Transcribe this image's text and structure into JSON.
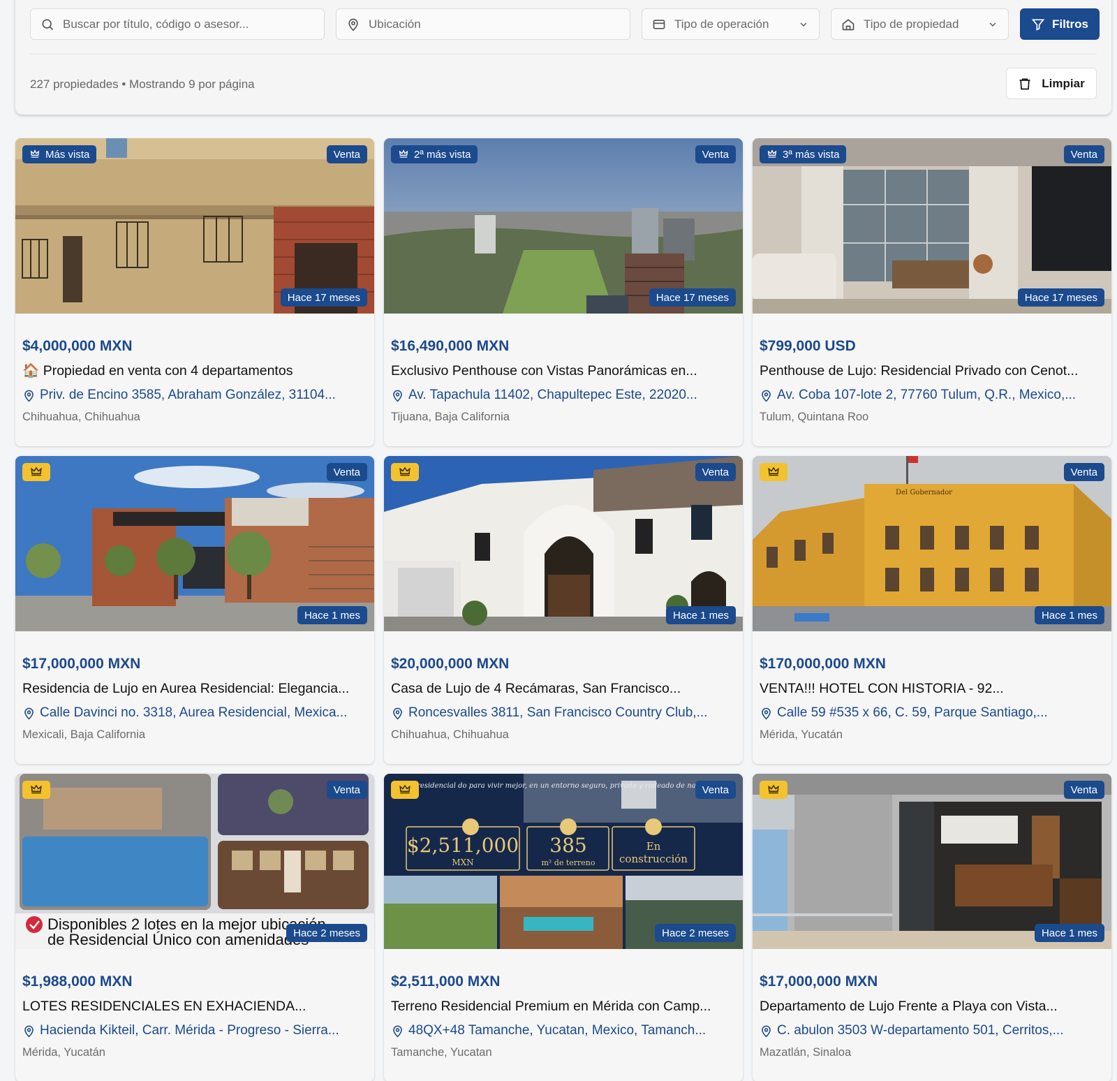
{
  "filters": {
    "search_placeholder": "Buscar por título, código o asesor...",
    "location_placeholder": "Ubicación",
    "operation_type": "Tipo de operación",
    "property_type": "Tipo de propiedad",
    "filters_button": "Filtros",
    "results_text": "227 propiedades • Mostrando 9 por página",
    "clear_button": "Limpiar"
  },
  "colors": {
    "brand": "#1b4a8d",
    "crown": "#f3c22e"
  },
  "cards": [
    {
      "rank": "Más vista",
      "operation": "Venta",
      "age": "Hace 17 meses",
      "price": "$4,000,000 MXN",
      "title": "🏠 Propiedad en venta con 4 departamentos",
      "address": "Priv. de Encino 3585, Abraham González, 31104...",
      "city": "Chihuahua, Chihuahua"
    },
    {
      "rank": "2ª más vista",
      "operation": "Venta",
      "age": "Hace 17 meses",
      "price": "$16,490,000 MXN",
      "title": "Exclusivo Penthouse con Vistas Panorámicas en...",
      "address": "Av. Tapachula 11402, Chapultepec Este, 22020...",
      "city": "Tijuana, Baja California"
    },
    {
      "rank": "3ª más vista",
      "operation": "Venta",
      "age": "Hace 17 meses",
      "price": "$799,000 USD",
      "title": "Penthouse de Lujo: Residencial Privado con Cenot...",
      "address": "Av. Coba 107-lote 2, 77760 Tulum, Q.R., Mexico,...",
      "city": "Tulum, Quintana Roo"
    },
    {
      "operation": "Venta",
      "age": "Hace 1 mes",
      "price": "$17,000,000 MXN",
      "title": "Residencia de Lujo en Aurea Residencial: Elegancia...",
      "address": "Calle Davinci no. 3318, Aurea Residencial, Mexica...",
      "city": "Mexicali, Baja California"
    },
    {
      "operation": "Venta",
      "age": "Hace 1 mes",
      "price": "$20,000,000 MXN",
      "title": "Casa de Lujo de 4 Recámaras, San Francisco...",
      "address": "Roncesvalles 3811, San Francisco Country Club,...",
      "city": "Chihuahua, Chihuahua"
    },
    {
      "operation": "Venta",
      "age": "Hace 1 mes",
      "price": "$170,000,000 MXN",
      "title": "VENTA!!! HOTEL CON HISTORIA - 92...",
      "address": "Calle 59 #535 x 66, C. 59, Parque Santiago,...",
      "city": "Mérida, Yucatán",
      "photo_text": "Del Gobernador"
    },
    {
      "operation": "Venta",
      "age": "Hace 2 meses",
      "price": "$1,988,000 MXN",
      "title": "LOTES RESIDENCIALES EN EXHACIENDA...",
      "address": "Hacienda Kikteil, Carr. Mérida - Progreso - Sierra...",
      "city": "Mérida, Yucatán",
      "photo_text_1": "Disponibles 2 lotes en la mejor ubicación",
      "photo_text_2": "de Residencial Único con amenidades"
    },
    {
      "operation": "Venta",
      "age": "Hace 2 meses",
      "price": "$2,511,000 MXN",
      "title": "Terreno Residencial Premium en Mérida con Camp...",
      "address": "48QX+48 Tamanche, Yucatan, Mexico, Tamanch...",
      "city": "Tamanche, Yucatan",
      "photo_caption": "arrollo residencial do para vivir mejor, en un entorno seguro, privado y rodeado de naturaleza.",
      "photo_price": "$2,511,000",
      "photo_price_unit": "MXN",
      "photo_area": "385",
      "photo_area_unit": "m² de terreno",
      "photo_status_1": "En",
      "photo_status_2": "construcción"
    },
    {
      "operation": "Venta",
      "age": "Hace 1 mes",
      "price": "$17,000,000 MXN",
      "title": "Departamento de Lujo Frente a Playa con Vista...",
      "address": "C. abulon 3503 W-departamento 501, Cerritos,...",
      "city": "Mazatlán, Sinaloa"
    }
  ]
}
